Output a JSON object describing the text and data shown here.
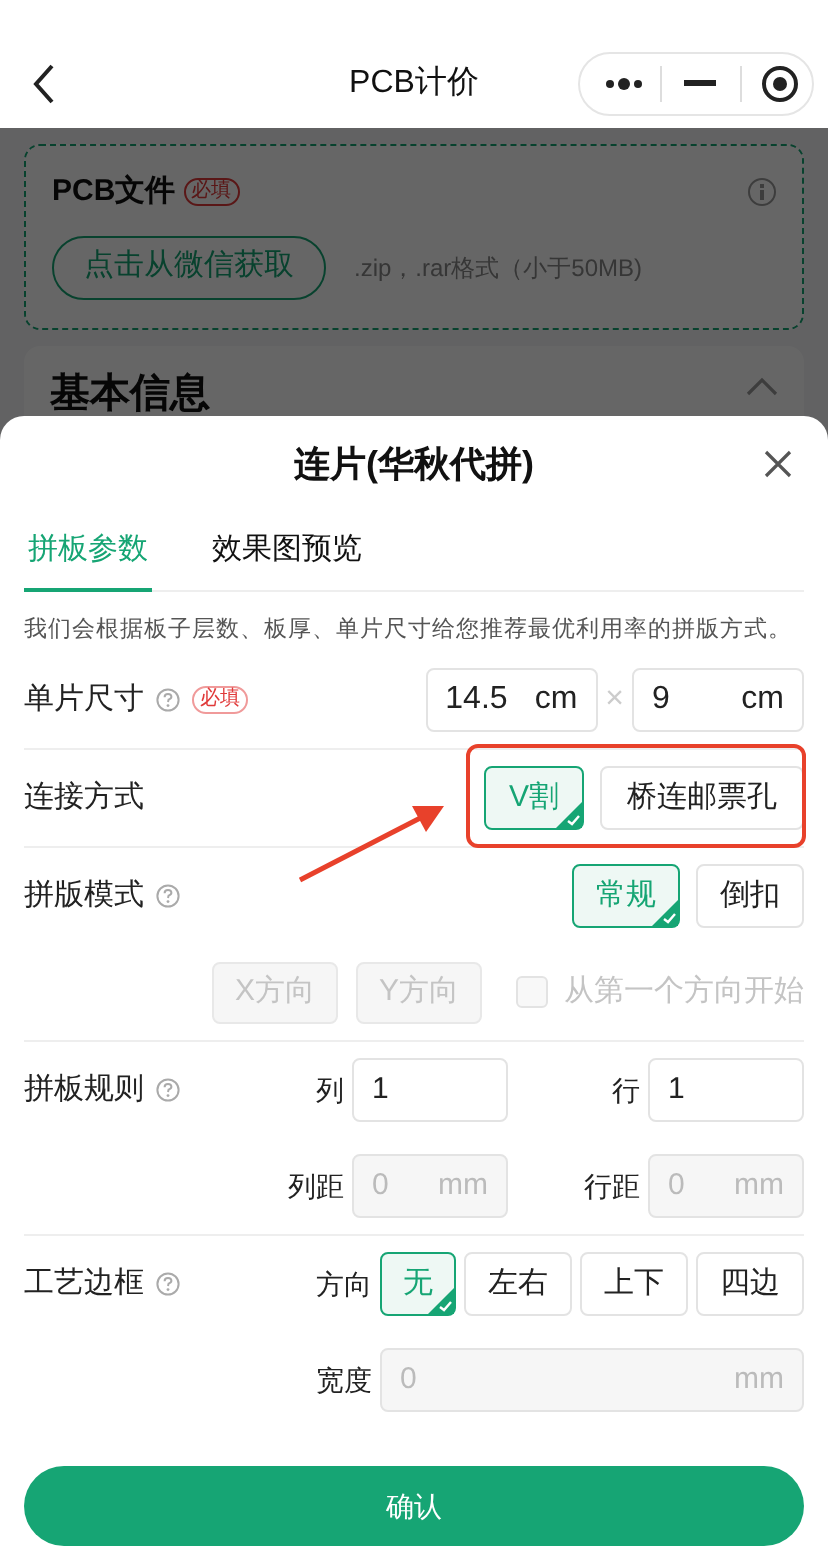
{
  "nav": {
    "title": "PCB计价"
  },
  "background": {
    "file_card": {
      "title": "PCB文件",
      "badge": "必填",
      "button": "点击从微信获取",
      "hint": ".zip，.rar格式（小于50MB)"
    },
    "section": {
      "title": "基本信息",
      "expanded": true
    }
  },
  "sheet": {
    "title": "连片(华秋代拼)",
    "tabs": [
      {
        "label": "拼板参数",
        "selected": true
      },
      {
        "label": "效果图预览",
        "selected": false
      }
    ],
    "description": "我们会根据板子层数、板厚、单片尺寸给您推荐最优利用率的拼版方式。",
    "size": {
      "label": "单片尺寸",
      "help": true,
      "badge": "必填",
      "separator": "×",
      "inputs": [
        {
          "value": "14.5",
          "unit": "cm"
        },
        {
          "value": "9",
          "unit": "cm"
        }
      ]
    },
    "connection": {
      "label": "连接方式",
      "help": false,
      "options": [
        {
          "label": "V割",
          "selected": true
        },
        {
          "label": "桥连邮票孔",
          "selected": false
        }
      ]
    },
    "mode": {
      "label": "拼版模式",
      "help": true,
      "options": [
        {
          "label": "常规",
          "selected": true
        },
        {
          "label": "倒扣",
          "selected": false
        }
      ],
      "directions": [
        {
          "label": "X方向",
          "disabled": true
        },
        {
          "label": "Y方向",
          "disabled": true
        }
      ],
      "checkbox": {
        "label": "从第一个方向开始",
        "checked": false,
        "disabled": true
      }
    },
    "rule": {
      "label": "拼板规则",
      "help": true,
      "fields": [
        {
          "label": "列",
          "value": "1",
          "disabled": false
        },
        {
          "label": "行",
          "value": "1",
          "disabled": false
        },
        {
          "label": "列距",
          "value": "0",
          "unit": "mm",
          "disabled": true
        },
        {
          "label": "行距",
          "value": "0",
          "unit": "mm",
          "disabled": true
        }
      ]
    },
    "edge": {
      "label": "工艺边框",
      "help": true,
      "direction_label": "方向",
      "options": [
        {
          "label": "无",
          "selected": true
        },
        {
          "label": "左右",
          "selected": false
        },
        {
          "label": "上下",
          "selected": false
        },
        {
          "label": "四边",
          "selected": false
        }
      ],
      "width": {
        "label": "宽度",
        "value": "0",
        "unit": "mm",
        "disabled": true
      }
    },
    "confirm": "确认"
  }
}
